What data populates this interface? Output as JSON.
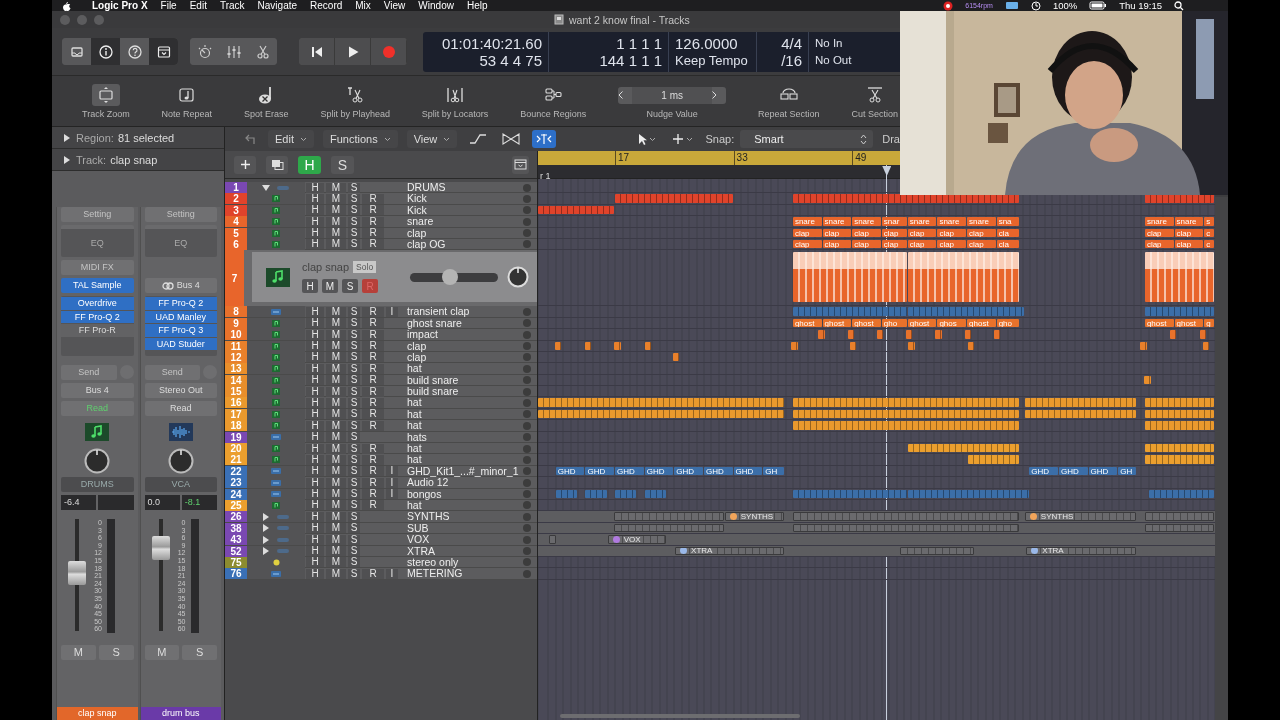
{
  "menu_bar": {
    "app": "Logic Pro X",
    "menus": [
      "File",
      "Edit",
      "Track",
      "Navigate",
      "Record",
      "Mix",
      "View",
      "Window",
      "Help"
    ],
    "rpm": "6154rpm",
    "battery": "100%",
    "clock": "Thu 19:15"
  },
  "window": {
    "title": "want 2 know final - Tracks"
  },
  "control_bar": {
    "view_buttons": [
      {
        "selected": false
      },
      {
        "selected": true
      },
      {
        "selected": false
      },
      {
        "selected": true
      }
    ],
    "lcd": {
      "time": "01:01:40:21.60",
      "time_sub": "53 4 4 75",
      "position": "1 1 1 1",
      "position_sub": "144 1 1 1",
      "tempo": "126.0000",
      "tempo_mode": "Keep Tempo",
      "signature": "4/4",
      "division": "/16",
      "midi_in": "No In",
      "midi_out": "No Out"
    }
  },
  "toolbar": [
    {
      "kind": "button",
      "label": "Track Zoom",
      "selected": true
    },
    {
      "kind": "button",
      "label": "Note Repeat",
      "selected": false
    },
    {
      "kind": "button",
      "label": "Spot Erase",
      "selected": false
    },
    {
      "kind": "button",
      "label": "Split by Playhead",
      "selected": false
    },
    {
      "kind": "button",
      "label": "Split by Locators",
      "selected": false
    },
    {
      "kind": "button",
      "label": "Bounce Regions",
      "selected": false
    },
    {
      "kind": "stepper",
      "label": "Nudge Value",
      "value": "1 ms"
    },
    {
      "kind": "button",
      "label": "Repeat Section",
      "selected": false
    },
    {
      "kind": "button",
      "label": "Cut Section",
      "selected": false
    }
  ],
  "inspector": {
    "region": {
      "label": "Region:",
      "value": "81 selected"
    },
    "track": {
      "label": "Track:",
      "value": "clap snap"
    },
    "strips": [
      {
        "setting": "Setting",
        "eq": "EQ",
        "midi_fx": "MIDI FX",
        "input": {
          "kind": "instrument",
          "label": "TAL Sample"
        },
        "inserts": [
          {
            "label": "Overdrive",
            "active": true
          },
          {
            "label": "FF Pro-Q 2",
            "active": true
          },
          {
            "label": "FF Pro-R",
            "active": false
          }
        ],
        "send": "Send",
        "output": "Bus 4",
        "automation": {
          "label": "Read",
          "active": true
        },
        "kind": "midi",
        "group": "DRUMS",
        "volume": "-6.4",
        "fader": {
          "level": 0.52
        },
        "scale": [
          "0",
          "3",
          "6",
          "9",
          "12",
          "15",
          "18",
          "21",
          "24",
          "30",
          "35",
          "40",
          "45",
          "50",
          "60"
        ],
        "mute": "M",
        "solo": "S",
        "name": "clap snap",
        "color": "#e2672a"
      },
      {
        "setting": "Setting",
        "eq": "EQ",
        "input": {
          "kind": "bus",
          "label": "Bus 4"
        },
        "inserts": [
          {
            "label": "FF Pro-Q 2",
            "active": true
          },
          {
            "label": "UAD Manley",
            "active": true
          },
          {
            "label": "FF Pro-Q 3",
            "active": true
          },
          {
            "label": "UAD Studer",
            "active": true
          }
        ],
        "send": "Send",
        "output": "Stereo Out",
        "automation": {
          "label": "Read",
          "active": false
        },
        "kind": "audio",
        "group": "VCA",
        "volume": "0.0",
        "peak": "-8.1",
        "fader": {
          "level": 0.74
        },
        "scale": [
          "0",
          "3",
          "6",
          "9",
          "12",
          "15",
          "18",
          "21",
          "24",
          "30",
          "35",
          "40",
          "45",
          "50",
          "60"
        ],
        "mute": "M",
        "solo": "S",
        "name": "drum bus",
        "color": "#6a3aa8"
      }
    ]
  },
  "arrange_bar": {
    "menus": [
      "Edit",
      "Functions",
      "View"
    ],
    "snap_label": "Snap:",
    "snap_value": "Smart",
    "drag_label": "Dra"
  },
  "track_header": [
    {
      "label": "H",
      "on": true
    },
    {
      "label": "S",
      "on": false
    }
  ],
  "ruler": {
    "bars": [
      "17",
      "33",
      "49"
    ],
    "marker": "r 1"
  },
  "tracks": [
    {
      "number": "1",
      "name": "DRUMS",
      "color": "#7a48b2",
      "kind": "stack",
      "expanded": true,
      "buttons": [
        "H",
        "M",
        "S"
      ],
      "selected": false,
      "children": [
        {
          "number": "2",
          "name": "Kick",
          "color": "#e0432b",
          "kind": "midi",
          "buttons": [
            "H",
            "M",
            "S",
            "R"
          ],
          "selected": false
        },
        {
          "number": "3",
          "name": "Kick",
          "color": "#e0432b",
          "kind": "midi",
          "buttons": [
            "H",
            "M",
            "S",
            "R"
          ],
          "selected": false
        },
        {
          "number": "4",
          "name": "snare",
          "color": "#e8652b",
          "kind": "midi",
          "buttons": [
            "H",
            "M",
            "S",
            "R"
          ],
          "selected": false,
          "regions": [
            {
              "label": "snare"
            },
            {
              "label": "snare"
            },
            {
              "label": "snare"
            },
            {
              "label": "snar"
            },
            {
              "label": "snare"
            },
            {
              "label": "snare"
            },
            {
              "label": "snare"
            },
            {
              "label": "sna"
            },
            {
              "label": "snare"
            },
            {
              "label": "snare"
            },
            {
              "label": "s"
            }
          ]
        },
        {
          "number": "5",
          "name": "clap",
          "color": "#e8652b",
          "kind": "midi",
          "buttons": [
            "H",
            "M",
            "S",
            "R"
          ],
          "selected": false,
          "regions": [
            {
              "label": "clap"
            },
            {
              "label": "clap"
            },
            {
              "label": "clap"
            },
            {
              "label": "clap"
            },
            {
              "label": "clap"
            },
            {
              "label": "clap"
            },
            {
              "label": "clap"
            },
            {
              "label": "cla"
            },
            {
              "label": "clap"
            },
            {
              "label": "clap"
            },
            {
              "label": "c"
            }
          ]
        },
        {
          "number": "6",
          "name": "clap OG",
          "color": "#e8652b",
          "kind": "midi",
          "buttons": [
            "H",
            "M",
            "S",
            "R"
          ],
          "selected": false,
          "regions": [
            {
              "label": "clap"
            },
            {
              "label": "clap"
            },
            {
              "label": "clap"
            },
            {
              "label": "clap"
            },
            {
              "label": "clap"
            },
            {
              "label": "clap"
            },
            {
              "label": "clap"
            },
            {
              "label": "cla"
            },
            {
              "label": "clap"
            },
            {
              "label": "clap"
            },
            {
              "label": "c"
            }
          ]
        },
        {
          "number": "7",
          "name": "clap snap",
          "color": "#e8652b",
          "kind": "midi",
          "buttons": [
            "H",
            "M",
            "S",
            "R"
          ],
          "selected": true,
          "tooltip": "Solo",
          "volume": {
            "level": 0.45
          }
        },
        {
          "number": "8",
          "name": "transient clap",
          "color": "#e8702b",
          "kind": "audio",
          "buttons": [
            "H",
            "M",
            "S",
            "R",
            "I"
          ],
          "selected": false
        },
        {
          "number": "9",
          "name": "ghost snare",
          "color": "#e8722b",
          "kind": "midi",
          "buttons": [
            "H",
            "M",
            "S",
            "R"
          ],
          "selected": false,
          "regions": [
            {
              "label": "ghost"
            },
            {
              "label": "ghost"
            },
            {
              "label": "ghost"
            },
            {
              "label": "gho"
            },
            {
              "label": "ghost"
            },
            {
              "label": "ghos"
            },
            {
              "label": "ghost"
            },
            {
              "label": "gho"
            },
            {
              "label": "ghost"
            },
            {
              "label": "ghost"
            },
            {
              "label": "g"
            }
          ]
        },
        {
          "number": "10",
          "name": "impact",
          "color": "#e8722b",
          "kind": "midi",
          "buttons": [
            "H",
            "M",
            "S",
            "R"
          ],
          "selected": false
        },
        {
          "number": "11",
          "name": "clap",
          "color": "#e8802b",
          "kind": "midi",
          "buttons": [
            "H",
            "M",
            "S",
            "R"
          ],
          "selected": false
        },
        {
          "number": "12",
          "name": "clap",
          "color": "#e8802b",
          "kind": "midi",
          "buttons": [
            "H",
            "M",
            "S",
            "R"
          ],
          "selected": false
        },
        {
          "number": "13",
          "name": "hat",
          "color": "#e88e2b",
          "kind": "midi",
          "buttons": [
            "H",
            "M",
            "S",
            "R"
          ],
          "selected": false
        },
        {
          "number": "14",
          "name": "build snare",
          "color": "#e88e2b",
          "kind": "midi",
          "buttons": [
            "H",
            "M",
            "S",
            "R"
          ],
          "selected": false
        },
        {
          "number": "15",
          "name": "build snare",
          "color": "#e88e2b",
          "kind": "midi",
          "buttons": [
            "H",
            "M",
            "S",
            "R"
          ],
          "selected": false
        },
        {
          "number": "16",
          "name": "hat",
          "color": "#ea992d",
          "kind": "midi",
          "buttons": [
            "H",
            "M",
            "S",
            "R"
          ],
          "selected": false
        },
        {
          "number": "17",
          "name": "hat",
          "color": "#ea992d",
          "kind": "midi",
          "buttons": [
            "H",
            "M",
            "S",
            "R"
          ],
          "selected": false
        },
        {
          "number": "18",
          "name": "hat",
          "color": "#ea992d",
          "kind": "midi",
          "buttons": [
            "H",
            "M",
            "S",
            "R"
          ],
          "selected": false
        },
        {
          "number": "19",
          "name": "hats",
          "color": "#7a48b2",
          "kind": "audio",
          "buttons": [
            "H",
            "M",
            "S"
          ],
          "selected": false
        },
        {
          "number": "20",
          "name": "hat",
          "color": "#eb9f2e",
          "kind": "midi",
          "buttons": [
            "H",
            "M",
            "S",
            "R"
          ],
          "selected": false
        },
        {
          "number": "21",
          "name": "hat",
          "color": "#eb9f2e",
          "kind": "midi",
          "buttons": [
            "H",
            "M",
            "S",
            "R"
          ],
          "selected": false
        },
        {
          "number": "22",
          "name": "GHD_Kit1_...#_minor_1",
          "color": "#3a70b6",
          "kind": "audio",
          "buttons": [
            "H",
            "M",
            "S",
            "R",
            "I"
          ],
          "selected": false,
          "regions": [
            {
              "label": "GHD_"
            },
            {
              "label": "GHD_"
            },
            {
              "label": "GHD_"
            },
            {
              "label": "GHD_"
            },
            {
              "label": "GHD_"
            },
            {
              "label": "GHD_"
            },
            {
              "label": "GHD_"
            },
            {
              "label": "GH"
            },
            {
              "label": "GHD_"
            },
            {
              "label": "GHD_"
            },
            {
              "label": "GHD_"
            },
            {
              "label": "GH"
            }
          ]
        },
        {
          "number": "23",
          "name": "Audio 12",
          "color": "#3a70b6",
          "kind": "audio",
          "buttons": [
            "H",
            "M",
            "S",
            "R",
            "I"
          ],
          "selected": false
        },
        {
          "number": "24",
          "name": "bongos",
          "color": "#3a70b6",
          "kind": "audio",
          "buttons": [
            "H",
            "M",
            "S",
            "R",
            "I"
          ],
          "selected": false
        },
        {
          "number": "25",
          "name": "hat",
          "color": "#eb9f2e",
          "kind": "midi",
          "buttons": [
            "H",
            "M",
            "S",
            "R"
          ],
          "selected": false
        }
      ]
    },
    {
      "number": "26",
      "name": "SYNTHS",
      "color": "#7a48b2",
      "kind": "stack",
      "expanded": false,
      "buttons": [
        "H",
        "M",
        "S"
      ],
      "selected": false,
      "regions": [
        {
          "label": "SYNTHS",
          "color": "#f0a45a"
        },
        {
          "label": "SYNTHS",
          "color": "#f0a45a"
        }
      ]
    },
    {
      "number": "38",
      "name": "SUB",
      "color": "#7a48b2",
      "kind": "stack",
      "expanded": false,
      "buttons": [
        "H",
        "M",
        "S"
      ],
      "selected": false
    },
    {
      "number": "43",
      "name": "VOX",
      "color": "#7a48b2",
      "kind": "stack",
      "expanded": false,
      "buttons": [
        "H",
        "M",
        "S"
      ],
      "selected": false,
      "regions": [
        {
          "label": "VOX",
          "color": "#b07ae0"
        }
      ]
    },
    {
      "number": "52",
      "name": "XTRA",
      "color": "#7a48b2",
      "kind": "stack",
      "expanded": false,
      "buttons": [
        "H",
        "M",
        "S"
      ],
      "selected": false,
      "regions": [
        {
          "label": "XTRA",
          "color": "#9ab8e8"
        },
        {
          "label": "XTRA",
          "color": "#9ab8e8"
        }
      ]
    },
    {
      "number": "75",
      "name": "stereo only",
      "color": "#8c8c30",
      "kind": "aux",
      "buttons": [
        "H",
        "M",
        "S"
      ],
      "selected": false
    },
    {
      "number": "76",
      "name": "METERING",
      "color": "#3a70b6",
      "kind": "audio",
      "buttons": [
        "H",
        "M",
        "S",
        "R",
        "I"
      ],
      "selected": false
    }
  ]
}
